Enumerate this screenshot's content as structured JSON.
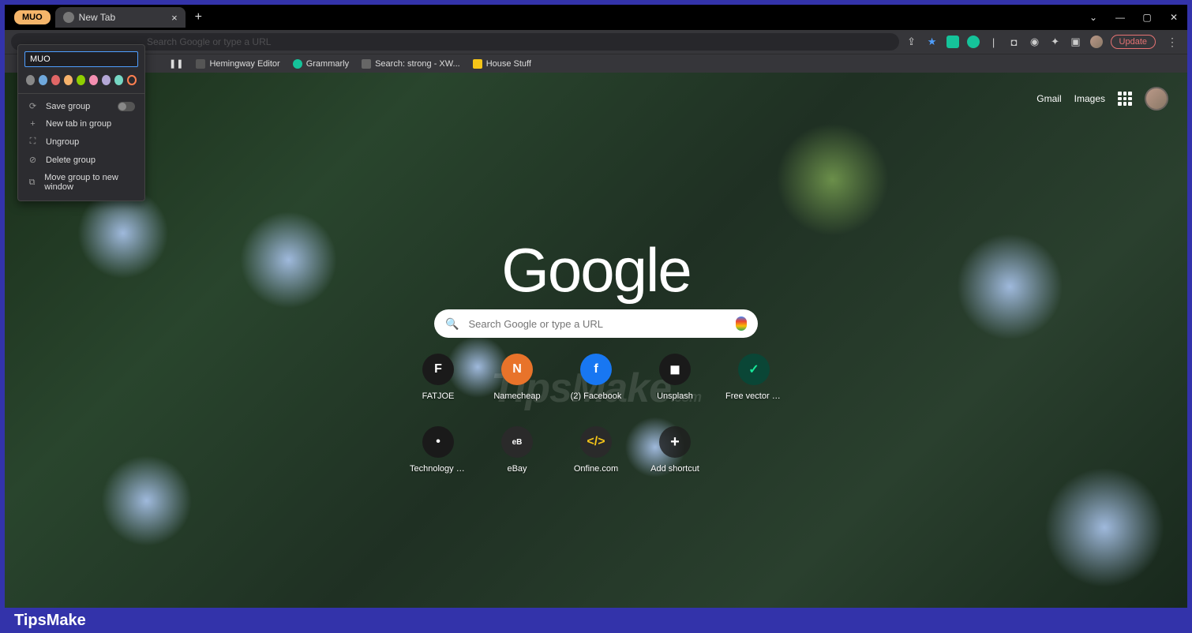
{
  "tab_group": {
    "name": "MUO"
  },
  "tab": {
    "title": "New Tab"
  },
  "omnibox": {
    "placeholder": "Search Google or type a URL"
  },
  "update_button": "Update",
  "bookmarks": [
    {
      "label": "Hemingway Editor",
      "color": "#555"
    },
    {
      "label": "Grammarly",
      "color": "#15c39a"
    },
    {
      "label": "Search: strong - XW...",
      "color": "#666"
    },
    {
      "label": "House Stuff",
      "color": "#f5c518"
    }
  ],
  "top_links": {
    "gmail": "Gmail",
    "images": "Images"
  },
  "google_logo": "Google",
  "search": {
    "placeholder": "Search Google or type a URL"
  },
  "shortcuts": [
    {
      "label": "FATJOE",
      "cls": "sc-dark",
      "glyph": "F"
    },
    {
      "label": "Namecheap",
      "cls": "sc-orange",
      "glyph": "N"
    },
    {
      "label": "(2) Facebook",
      "cls": "sc-blue",
      "glyph": "f"
    },
    {
      "label": "Unsplash",
      "cls": "sc-dark",
      "glyph": "◼"
    },
    {
      "label": "Free vector ic...",
      "cls": "sc-green",
      "glyph": "✓"
    },
    {
      "label": "Technology O...",
      "cls": "sc-dark",
      "glyph": "•"
    },
    {
      "label": "eBay",
      "cls": "sc-ebay",
      "glyph": "eB"
    },
    {
      "label": "Onfine.com",
      "cls": "sc-yellow",
      "glyph": "</>"
    },
    {
      "label": "Add shortcut",
      "cls": "sc-add",
      "glyph": "+"
    }
  ],
  "context_menu": {
    "input_value": "MUO",
    "colors": [
      "#888888",
      "#6fa8dc",
      "#e06666",
      "#f6b26b",
      "#8fce00",
      "#f48fb1",
      "#b4a7d6",
      "#76d7c4",
      "#ff7f50"
    ],
    "save_group": "Save group",
    "new_tab": "New tab in group",
    "ungroup": "Ungroup",
    "delete": "Delete group",
    "move": "Move group to new window"
  },
  "watermark": {
    "main": "TipsMake",
    "sub": ".com"
  },
  "footer": "TipsMake"
}
